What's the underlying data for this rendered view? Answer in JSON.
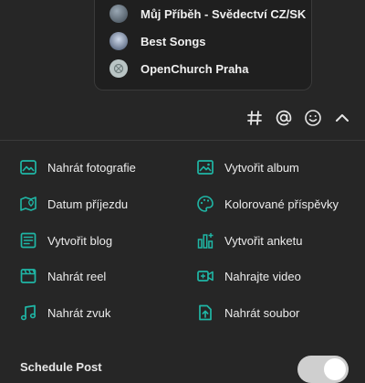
{
  "dropdown": {
    "items": [
      {
        "label": "Můj Příběh - Svědectví CZ/SK",
        "avatar": "avatar-story",
        "color": "#6a7a8a"
      },
      {
        "label": "Best Songs",
        "avatar": "avatar-songs",
        "color": "#8fa3c4"
      },
      {
        "label": "OpenChurch Praha",
        "avatar": "avatar-openchurch",
        "color": "#b9c4c4"
      }
    ]
  },
  "toolbar": {
    "hashtag_icon": "hashtag-icon",
    "mention_icon": "at-icon",
    "emoji_icon": "smiley-icon",
    "collapse_icon": "chevron-up-icon"
  },
  "options": {
    "upload_photo": "Nahrát fotografie",
    "create_album": "Vytvořit album",
    "arrival_date": "Datum příjezdu",
    "colored_posts": "Kolorované příspěvky",
    "create_blog": "Vytvořit blog",
    "create_poll": "Vytvořit anketu",
    "upload_reel": "Nahrát reel",
    "upload_video": "Nahrajte video",
    "upload_audio": "Nahrát zvuk",
    "upload_file": "Nahrát soubor"
  },
  "accent_color": "#1fb7a6",
  "footer": {
    "label": "Schedule Post",
    "toggle_on": false
  }
}
